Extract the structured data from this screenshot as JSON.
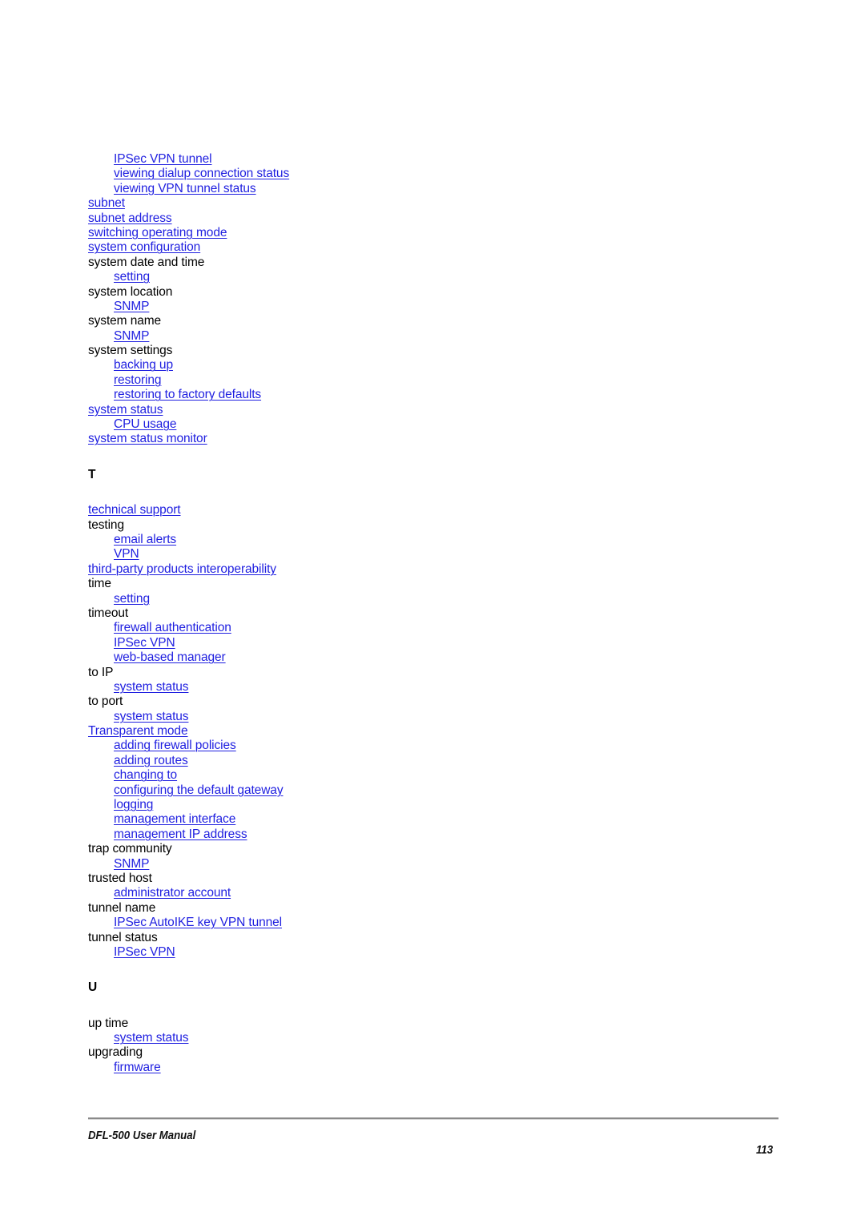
{
  "document": {
    "kind": "index-page",
    "footer": {
      "title": "DFL-500 User Manual",
      "page_number": "113"
    },
    "link_color": "#1f1fe0",
    "text_color": "#000000"
  },
  "index": {
    "groups": [
      {
        "letter": "",
        "show_letter": false,
        "entries": [
          {
            "text": "IPSec VPN tunnel",
            "level": 1,
            "link": true
          },
          {
            "text": "viewing dialup connection status",
            "level": 1,
            "link": true
          },
          {
            "text": "viewing VPN tunnel status",
            "level": 1,
            "link": true
          },
          {
            "text": "subnet",
            "level": 0,
            "link": true
          },
          {
            "text": "subnet address",
            "level": 0,
            "link": true
          },
          {
            "text": "switching operating mode",
            "level": 0,
            "link": true
          },
          {
            "text": "system configuration",
            "level": 0,
            "link": true
          },
          {
            "text": "system date and time",
            "level": 0,
            "link": false
          },
          {
            "text": "setting",
            "level": 1,
            "link": true
          },
          {
            "text": "system location",
            "level": 0,
            "link": false
          },
          {
            "text": "SNMP",
            "level": 1,
            "link": true
          },
          {
            "text": "system name",
            "level": 0,
            "link": false
          },
          {
            "text": "SNMP",
            "level": 1,
            "link": true
          },
          {
            "text": "system settings",
            "level": 0,
            "link": false
          },
          {
            "text": "backing up",
            "level": 1,
            "link": true
          },
          {
            "text": "restoring",
            "level": 1,
            "link": true
          },
          {
            "text": "restoring to factory defaults",
            "level": 1,
            "link": true
          },
          {
            "text": "system status",
            "level": 0,
            "link": true
          },
          {
            "text": "CPU usage",
            "level": 1,
            "link": true
          },
          {
            "text": "system status monitor",
            "level": 0,
            "link": true
          }
        ]
      },
      {
        "letter": "T",
        "show_letter": true,
        "entries": [
          {
            "text": "technical support",
            "level": 0,
            "link": true
          },
          {
            "text": "testing",
            "level": 0,
            "link": false
          },
          {
            "text": "email alerts",
            "level": 1,
            "link": true
          },
          {
            "text": "VPN",
            "level": 1,
            "link": true
          },
          {
            "text": "third-party products interoperability",
            "level": 0,
            "link": true
          },
          {
            "text": "time",
            "level": 0,
            "link": false
          },
          {
            "text": "setting",
            "level": 1,
            "link": true
          },
          {
            "text": "timeout",
            "level": 0,
            "link": false
          },
          {
            "text": "firewall authentication",
            "level": 1,
            "link": true
          },
          {
            "text": "IPSec VPN",
            "level": 1,
            "link": true
          },
          {
            "text": "web-based manager",
            "level": 1,
            "link": true
          },
          {
            "text": "to IP",
            "level": 0,
            "link": false
          },
          {
            "text": "system status",
            "level": 1,
            "link": true
          },
          {
            "text": "to port",
            "level": 0,
            "link": false
          },
          {
            "text": "system status",
            "level": 1,
            "link": true
          },
          {
            "text": "Transparent mode",
            "level": 0,
            "link": true
          },
          {
            "text": "adding firewall policies",
            "level": 1,
            "link": true
          },
          {
            "text": "adding routes",
            "level": 1,
            "link": true
          },
          {
            "text": "changing to",
            "level": 1,
            "link": true
          },
          {
            "text": "configuring the default gateway",
            "level": 1,
            "link": true
          },
          {
            "text": "logging",
            "level": 1,
            "link": true
          },
          {
            "text": "management interface",
            "level": 1,
            "link": true
          },
          {
            "text": "management IP address",
            "level": 1,
            "link": true
          },
          {
            "text": "trap community",
            "level": 0,
            "link": false
          },
          {
            "text": "SNMP",
            "level": 1,
            "link": true
          },
          {
            "text": "trusted host",
            "level": 0,
            "link": false
          },
          {
            "text": "administrator account",
            "level": 1,
            "link": true
          },
          {
            "text": "tunnel name",
            "level": 0,
            "link": false
          },
          {
            "text": "IPSec AutoIKE key VPN tunnel",
            "level": 1,
            "link": true
          },
          {
            "text": "tunnel status",
            "level": 0,
            "link": false
          },
          {
            "text": "IPSec VPN",
            "level": 1,
            "link": true
          }
        ]
      },
      {
        "letter": "U",
        "show_letter": true,
        "entries": [
          {
            "text": "up time",
            "level": 0,
            "link": false
          },
          {
            "text": "system status",
            "level": 1,
            "link": true
          },
          {
            "text": "upgrading",
            "level": 0,
            "link": false
          },
          {
            "text": "firmware",
            "level": 1,
            "link": true
          }
        ]
      }
    ]
  }
}
